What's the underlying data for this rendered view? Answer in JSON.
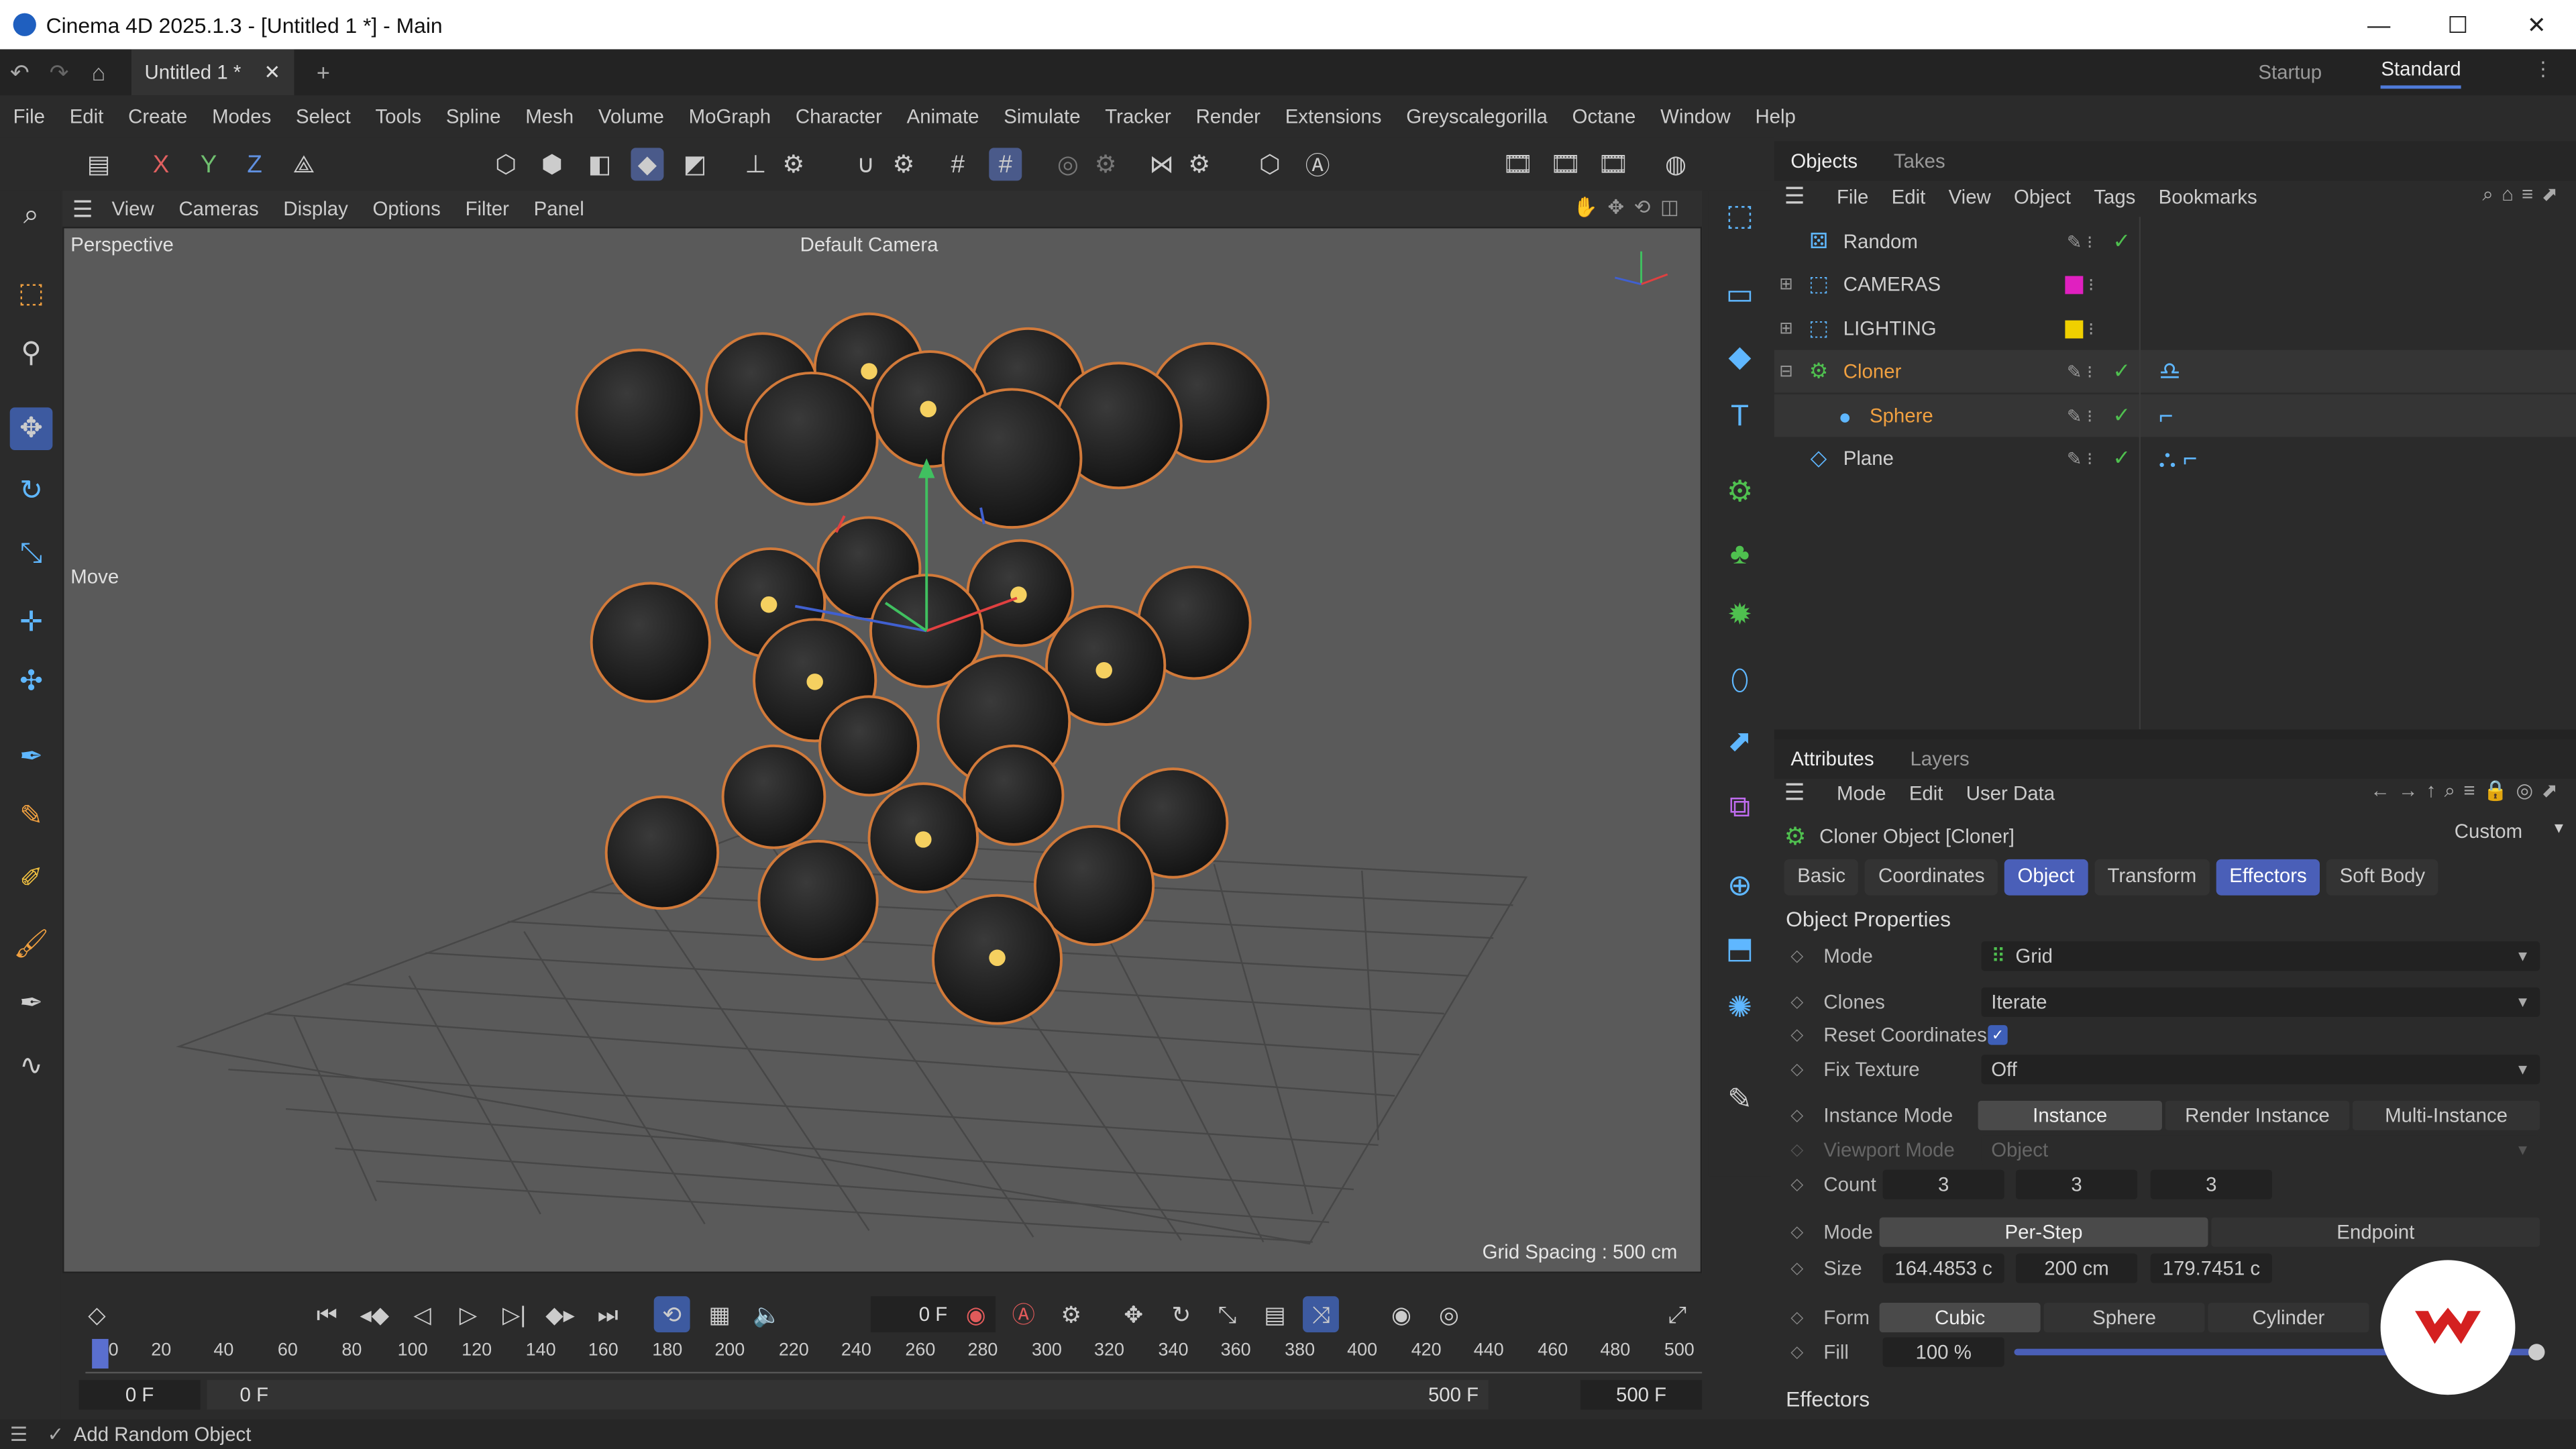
{
  "window": {
    "app_icon": "cinema4d-logo-icon",
    "title": "Cinema 4D 2025.1.3 - [Untitled 1 *] - Main",
    "controls": [
      "—",
      "☐",
      "✕"
    ]
  },
  "tabbar": {
    "doc_tab": "Untitled 1 *",
    "layouts": [
      "Startup",
      "Standard"
    ]
  },
  "menu": [
    "File",
    "Edit",
    "Create",
    "Modes",
    "Select",
    "Tools",
    "Spline",
    "Mesh",
    "Volume",
    "MoGraph",
    "Character",
    "Animate",
    "Simulate",
    "Tracker",
    "Render",
    "Extensions",
    "Greyscalegorilla",
    "Octane",
    "Window",
    "Help"
  ],
  "toolbar": {
    "axes": [
      "X",
      "Y",
      "Z"
    ]
  },
  "viewport": {
    "menu": [
      "View",
      "Cameras",
      "Display",
      "Options",
      "Filter",
      "Panel"
    ],
    "projection": "Perspective",
    "camera": "Default Camera",
    "tool_label": "Move",
    "grid_spacing": "Grid Spacing : 500 cm"
  },
  "objects_panel": {
    "tabs": [
      "Objects",
      "Takes"
    ],
    "menu": [
      "File",
      "Edit",
      "View",
      "Object",
      "Tags",
      "Bookmarks"
    ],
    "rows": [
      {
        "name": "Random",
        "color": "#cfcfcf"
      },
      {
        "name": "CAMERAS",
        "color": "#cfcfcf",
        "layer_color": "#e020c0"
      },
      {
        "name": "LIGHTING",
        "color": "#cfcfcf",
        "layer_color": "#f0d000"
      },
      {
        "name": "Cloner",
        "color": "#f0a040"
      },
      {
        "name": "Sphere",
        "color": "#f0a040"
      },
      {
        "name": "Plane",
        "color": "#cfcfcf"
      }
    ]
  },
  "attributes": {
    "tabs": [
      "Attributes",
      "Layers"
    ],
    "menu": [
      "Mode",
      "Edit",
      "User Data"
    ],
    "object_title": "Cloner Object [Cloner]",
    "preset": "Custom",
    "subtabs": [
      "Basic",
      "Coordinates",
      "Object",
      "Transform",
      "Effectors",
      "Soft Body"
    ],
    "section": "Object Properties",
    "mode_label": "Mode",
    "mode_value": "Grid",
    "clones_label": "Clones",
    "clones_value": "Iterate",
    "reset_label": "Reset Coordinates",
    "fix_label": "Fix Texture",
    "fix_value": "Off",
    "instance_label": "Instance Mode",
    "instance_options": [
      "Instance",
      "Render Instance",
      "Multi-Instance"
    ],
    "viewport_label": "Viewport Mode",
    "viewport_value": "Object",
    "count_label": "Count",
    "count_values": [
      "3",
      "3",
      "3"
    ],
    "mode2_label": "Mode",
    "mode2_options": [
      "Per-Step",
      "Endpoint"
    ],
    "size_label": "Size",
    "size_values": [
      "164.4853 c",
      "200 cm",
      "179.7451 c"
    ],
    "form_label": "Form",
    "form_options": [
      "Cubic",
      "Sphere",
      "Cylinder"
    ],
    "fill_label": "Fill",
    "fill_value": "100 %",
    "fill_fraction": 1.0,
    "effectors_section": "Effectors"
  },
  "timeline": {
    "current_frame": "0 F",
    "ticks": [
      "0",
      "20",
      "40",
      "60",
      "80",
      "100",
      "120",
      "140",
      "160",
      "180",
      "200",
      "220",
      "240",
      "260",
      "280",
      "300",
      "320",
      "340",
      "360",
      "380",
      "400",
      "420",
      "440",
      "460",
      "480",
      "500"
    ],
    "range_start": "0 F",
    "range_start2": "0 F",
    "range_end": "500 F",
    "range_end2": "500 F"
  },
  "status": {
    "text": "Add Random Object"
  }
}
